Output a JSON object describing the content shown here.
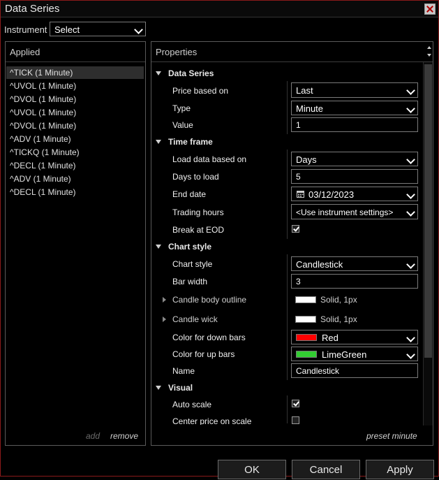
{
  "window": {
    "title": "Data Series"
  },
  "instrument": {
    "label": "Instrument",
    "value": "Select"
  },
  "applied": {
    "header": "Applied",
    "items": [
      "^TICK (1 Minute)",
      "^UVOL (1 Minute)",
      "^DVOL (1 Minute)",
      "^UVOL (1 Minute)",
      "^DVOL (1 Minute)",
      "^ADV (1 Minute)",
      "^TICKQ (1 Minute)",
      "^DECL (1 Minute)",
      "^ADV (1 Minute)",
      "^DECL (1 Minute)"
    ],
    "selected_index": 0,
    "add": "add",
    "remove": "remove"
  },
  "properties": {
    "header": "Properties",
    "preset": "preset minute",
    "sections": {
      "data_series": {
        "title": "Data Series",
        "price_based_on": {
          "label": "Price based on",
          "value": "Last"
        },
        "type": {
          "label": "Type",
          "value": "Minute"
        },
        "value": {
          "label": "Value",
          "value": "1"
        }
      },
      "time_frame": {
        "title": "Time frame",
        "load_data_based_on": {
          "label": "Load data based on",
          "value": "Days"
        },
        "days_to_load": {
          "label": "Days to load",
          "value": "5"
        },
        "end_date": {
          "label": "End date",
          "value": "03/12/2023"
        },
        "trading_hours": {
          "label": "Trading hours",
          "value": "<Use instrument settings>"
        },
        "break_at_eod": {
          "label": "Break at EOD",
          "checked": true
        }
      },
      "chart_style": {
        "title": "Chart style",
        "chart_style": {
          "label": "Chart style",
          "value": "Candlestick"
        },
        "bar_width": {
          "label": "Bar width",
          "value": "3"
        },
        "candle_body_outline": {
          "label": "Candle body outline",
          "value": "Solid, 1px",
          "color": "#ffffff"
        },
        "candle_wick": {
          "label": "Candle wick",
          "value": "Solid, 1px",
          "color": "#ffffff"
        },
        "color_down": {
          "label": "Color for down bars",
          "value": "Red",
          "color": "#ff0000"
        },
        "color_up": {
          "label": "Color for up bars",
          "value": "LimeGreen",
          "color": "#32cd32"
        },
        "name": {
          "label": "Name",
          "value": "Candlestick"
        }
      },
      "visual": {
        "title": "Visual",
        "auto_scale": {
          "label": "Auto scale",
          "checked": true
        },
        "center_price": {
          "label": "Center price on scale",
          "checked": false
        }
      }
    }
  },
  "buttons": {
    "ok": "OK",
    "cancel": "Cancel",
    "apply": "Apply"
  },
  "colors": {
    "frame_border": "#8b1a1a",
    "background": "#000000"
  }
}
